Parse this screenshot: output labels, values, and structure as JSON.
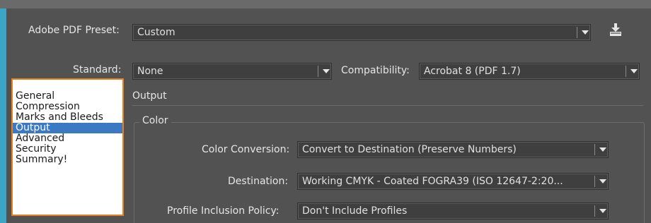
{
  "preset": {
    "label": "Adobe PDF Preset:",
    "value": "Custom"
  },
  "standard": {
    "label": "Standard:",
    "value": "None"
  },
  "compatibility": {
    "label": "Compatibility:",
    "value": "Acrobat 8 (PDF 1.7)"
  },
  "sidebar": {
    "items": [
      {
        "label": "General"
      },
      {
        "label": "Compression"
      },
      {
        "label": "Marks and Bleeds"
      },
      {
        "label": "Output"
      },
      {
        "label": "Advanced"
      },
      {
        "label": "Security"
      },
      {
        "label": "Summary!"
      }
    ],
    "selected": "Output"
  },
  "section": {
    "title": "Output"
  },
  "color_group": {
    "title": "Color",
    "conversion": {
      "label": "Color Conversion:",
      "value": "Convert to Destination (Preserve Numbers)"
    },
    "destination": {
      "label": "Destination:",
      "value": "Working CMYK - Coated FOGRA39 (ISO 12647-2:20..."
    },
    "profile": {
      "label": "Profile Inclusion Policy:",
      "value": "Don't Include Profiles"
    }
  },
  "icons": {
    "save_preset": "save-preset-icon",
    "dropdown": "chevron-down-icon"
  },
  "colors": {
    "accent_left": "#3aa5c7",
    "sidebar_border": "#e8801e",
    "selection": "#3c79c4",
    "background": "#525252"
  }
}
